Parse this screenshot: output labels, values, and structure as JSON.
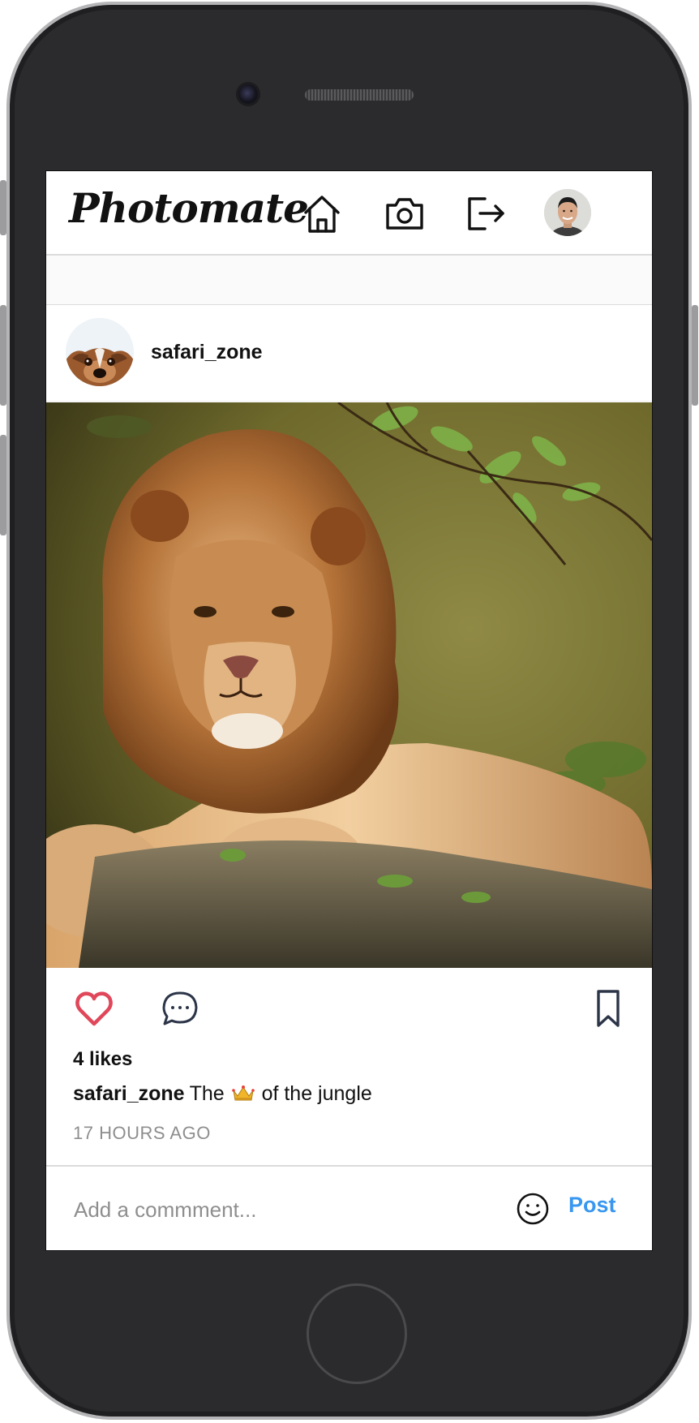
{
  "app": {
    "name": "Photomate"
  },
  "nav": {
    "icons": [
      "home-icon",
      "camera-icon",
      "logout-icon"
    ],
    "avatar": "user-avatar"
  },
  "post": {
    "username": "safari_zone",
    "avatar": "dog-avatar",
    "image": "lion-photo",
    "liked": true,
    "likes": "4 likes",
    "caption_user": "safari_zone",
    "caption_before": "The",
    "caption_emoji": "crown",
    "caption_after": "of the jungle",
    "timestamp": "17 HOURS AGO"
  },
  "comment_box": {
    "placeholder": "Add a commment...",
    "post_label": "Post"
  },
  "colors": {
    "like": "#e0475a",
    "accent": "#3897f0",
    "muted": "#8e8e8e",
    "frame": "#2b2b2d"
  }
}
